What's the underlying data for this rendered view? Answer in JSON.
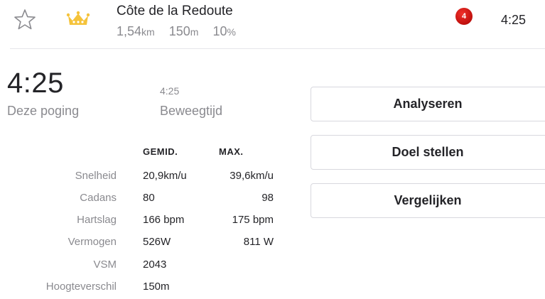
{
  "header": {
    "segment_name": "Côte de la Redoute",
    "distance_value": "1,54",
    "distance_unit": "km",
    "elevation_value": "150",
    "elevation_unit": "m",
    "grade_value": "10",
    "grade_unit": "%",
    "rank": "4",
    "time": "4:25",
    "star_icon": "star-outline-icon",
    "crown_icon": "crown-icon",
    "crown_color": "#f5c33b",
    "rank_color": "#d0130f"
  },
  "effort": {
    "time": "4:25",
    "time_label": "Deze poging",
    "moving_time": "4:25",
    "moving_time_label": "Beweegtijd"
  },
  "stats": {
    "avg_header": "GEMID.",
    "max_header": "MAX.",
    "rows": [
      {
        "label": "Snelheid",
        "avg": "20,9km/u",
        "max": "39,6km/u"
      },
      {
        "label": "Cadans",
        "avg": "80",
        "max": "98"
      },
      {
        "label": "Hartslag",
        "avg": "166 bpm",
        "max": "175 bpm"
      },
      {
        "label": "Vermogen",
        "avg": "526W",
        "max": "811 W"
      },
      {
        "label": "VSM",
        "avg": "2043",
        "max": ""
      },
      {
        "label": "Hoogteverschil",
        "avg": "150m",
        "max": ""
      }
    ]
  },
  "actions": {
    "analyze": "Analyseren",
    "set_goal": "Doel stellen",
    "compare": "Vergelijken"
  }
}
